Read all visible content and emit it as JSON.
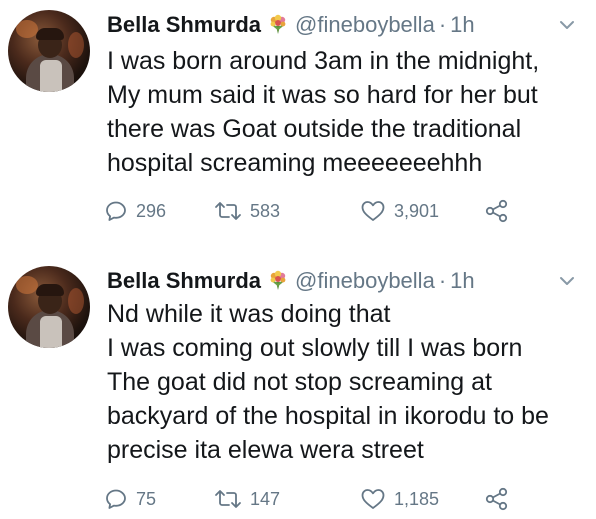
{
  "tweets": [
    {
      "author_name": "Bella Shmurda",
      "handle": "@fineboybella",
      "separator": "·",
      "time": "1h",
      "badge_icon": "bouquet-emoji",
      "text": "I was born around 3am in the midnight,\nMy mum said it was so hard for her but\nthere was Goat outside the traditional\nhospital screaming meeeeeeehhh",
      "replies": "296",
      "retweets": "583",
      "likes": "3,901"
    },
    {
      "author_name": "Bella Shmurda",
      "handle": "@fineboybella",
      "separator": "·",
      "time": "1h",
      "badge_icon": "bouquet-emoji",
      "text": "Nd while it was doing that\nI was coming out slowly till I was born\n The goat did not stop screaming at\nbackyard of the hospital in ikorodu to be\nprecise ita elewa wera street",
      "replies": "75",
      "retweets": "147",
      "likes": "1,185"
    }
  ],
  "colors": {
    "text_primary": "#14171a",
    "text_secondary": "#657786",
    "background": "#ffffff"
  }
}
